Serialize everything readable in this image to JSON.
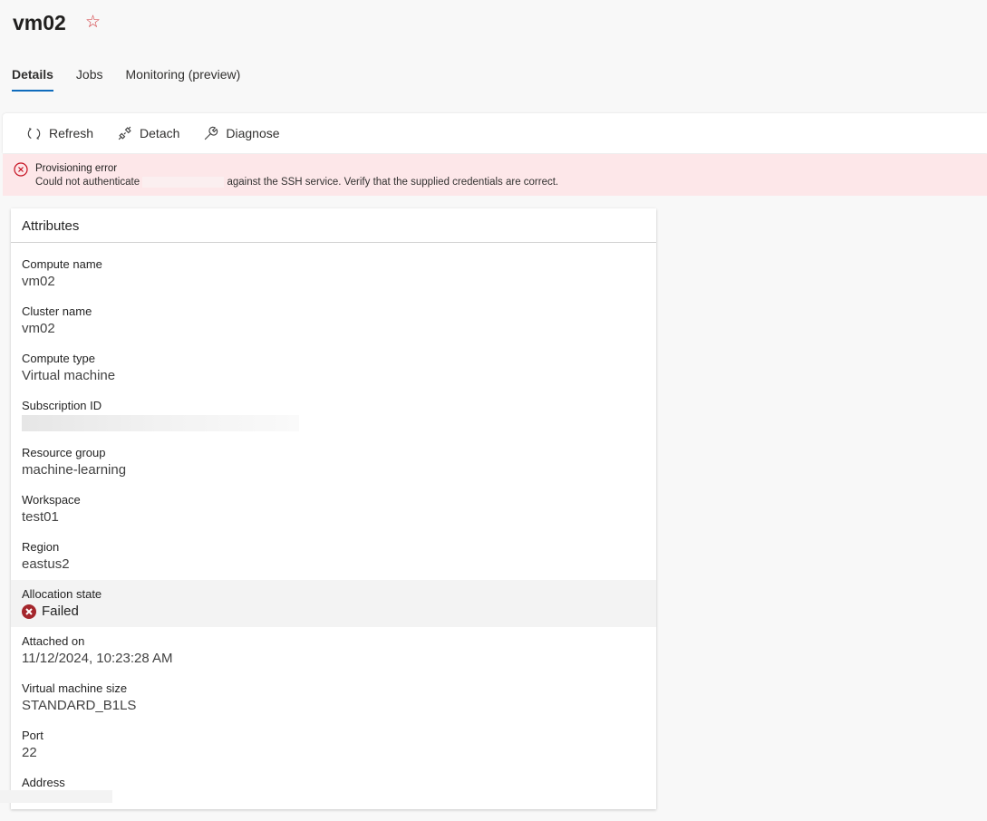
{
  "page": {
    "title": "vm02",
    "favorite_icon": "star-outline-icon"
  },
  "tabs": [
    {
      "label": "Details",
      "active": true
    },
    {
      "label": "Jobs"
    },
    {
      "label": "Monitoring (preview)"
    }
  ],
  "toolbar": {
    "refresh": "Refresh",
    "detach": "Detach",
    "diagnose": "Diagnose"
  },
  "error": {
    "title": "Provisioning error",
    "message_before": "Could not authenticate",
    "message_after": "against the SSH service. Verify that the supplied credentials are correct.",
    "color": "#fde7e9"
  },
  "attributes": {
    "header": "Attributes",
    "compute_name": {
      "label": "Compute name",
      "value": "vm02"
    },
    "cluster_name": {
      "label": "Cluster name",
      "value": "vm02"
    },
    "compute_type": {
      "label": "Compute type",
      "value": "Virtual machine"
    },
    "subscription_id": {
      "label": "Subscription ID"
    },
    "resource_group": {
      "label": "Resource group",
      "value": "machine-learning"
    },
    "workspace": {
      "label": "Workspace",
      "value": "test01"
    },
    "region": {
      "label": "Region",
      "value": "eastus2"
    },
    "allocation_state": {
      "label": "Allocation state",
      "value": "Failed",
      "status_color": "#c50f1f"
    },
    "attached_on": {
      "label": "Attached on",
      "value": "11/12/2024, 10:23:28 AM"
    },
    "vm_size": {
      "label": "Virtual machine size",
      "value": "STANDARD_B1LS"
    },
    "port": {
      "label": "Port",
      "value": "22"
    },
    "address": {
      "label": "Address"
    }
  }
}
